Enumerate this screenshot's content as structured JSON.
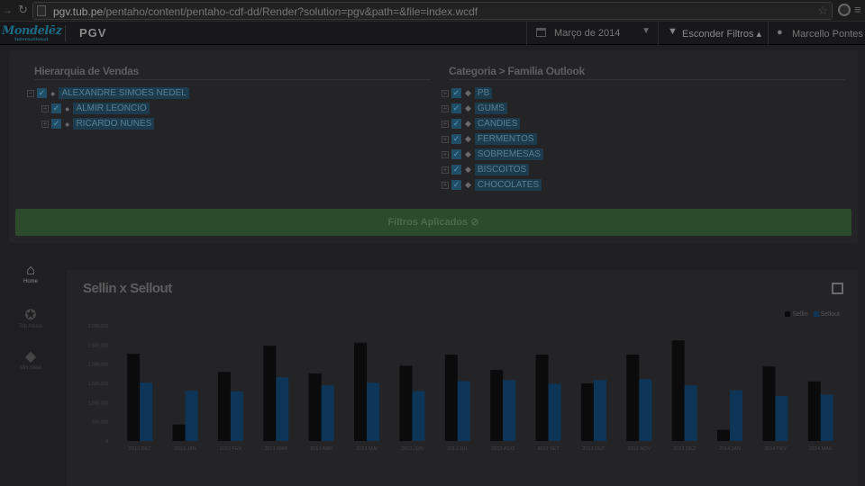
{
  "browser": {
    "url_host": "pgv.tub.pe",
    "url_path": "/pentaho/content/pentaho-cdf-dd/Render?solution=pgv&path=&file=index.wcdf"
  },
  "app": {
    "logo_text": "Mondelēz",
    "logo_sub": "International",
    "name": "PGV",
    "date_filter": "Março de 2014",
    "toggle_filters": "Esconder Filtros",
    "user_name": "Marcello Pontes"
  },
  "filters": {
    "hierarchy_title": "Hierarquia de Vendas",
    "hierarchy": [
      {
        "label": "ALEXANDRE SIMOES NEDEL",
        "level": 0
      },
      {
        "label": "ALMIR LEONCIO",
        "level": 1
      },
      {
        "label": "RICARDO NUNES",
        "level": 1
      }
    ],
    "category_title": "Categoria > Família Outlook",
    "categories": [
      "PB",
      "GUMS",
      "CANDIES",
      "FERMENTOS",
      "SOBREMESAS",
      "BISCOITOS",
      "CHOCOLATES"
    ],
    "applied_label": "Filtros Aplicados"
  },
  "sidebar": [
    {
      "label": "Home",
      "icon": "home-icon",
      "active": true
    },
    {
      "label": "Top Ativos",
      "icon": "medal-icon",
      "active": false
    },
    {
      "label": "Mix Ideal",
      "icon": "tag-icon",
      "active": false
    }
  ],
  "chart_title": "Sellin x Sellout",
  "chart_data": {
    "type": "bar",
    "categories": [
      "2013 DEZ",
      "2013 JAN",
      "2013 FEV",
      "2013 MAR",
      "2013 ABR",
      "2013 MAI",
      "2013 JUN",
      "2013 JUL",
      "2013 AGO",
      "2013 SET",
      "2013 OUT",
      "2013 NOV",
      "2013 DEZ",
      "2014 JAN",
      "2014 FEV",
      "2014 MAR"
    ],
    "series": [
      {
        "name": "Sellin",
        "color": "#0b0b0c",
        "values": [
          2270000,
          430000,
          1800000,
          2480000,
          1760000,
          2560000,
          1960000,
          2250000,
          1850000,
          2250000,
          1500000,
          2250000,
          2620000,
          290000,
          1940000,
          1550000
        ]
      },
      {
        "name": "Sellout",
        "color": "#0d3557",
        "values": [
          1520000,
          1310000,
          1290000,
          1660000,
          1450000,
          1520000,
          1300000,
          1560000,
          1590000,
          1490000,
          1590000,
          1610000,
          1450000,
          1320000,
          1170000,
          1210000
        ]
      }
    ],
    "ylim": [
      0,
      3000000
    ],
    "yticks": [
      "0",
      "500,000",
      "1,000,000",
      "1,500,000",
      "2,000,000",
      "2,500,000",
      "3,000,000"
    ],
    "legend_position": "top-right",
    "grid": false
  }
}
